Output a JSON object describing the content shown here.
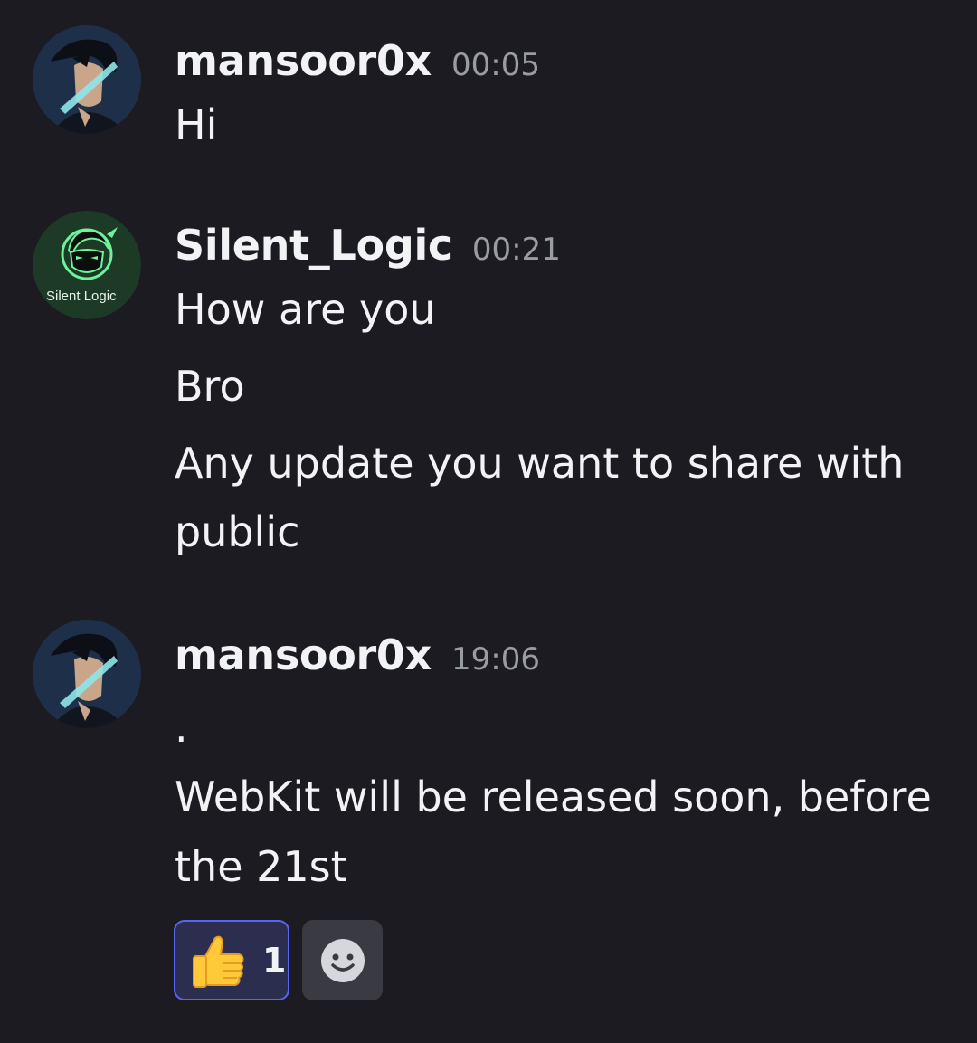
{
  "messages": [
    {
      "author": "mansoor0x",
      "time": "00:05",
      "lines": [
        "Hi"
      ],
      "avatar_icon": "user-avatar"
    },
    {
      "author": "Silent_Logic",
      "time": "00:21",
      "lines": [
        "How are you",
        "Bro",
        "Any update you want to share with",
        "public"
      ],
      "avatar_icon": "silent-logic-logo",
      "avatar_text": "Silent Logic"
    },
    {
      "author": "mansoor0x",
      "time": "19:06",
      "lines": [
        ".",
        "WebKit will be released soon, before",
        "the 21st"
      ],
      "avatar_icon": "user-avatar"
    }
  ],
  "reactions": [
    {
      "emoji": "thumbs-up-icon",
      "count": "1"
    }
  ],
  "add_reaction_icon": "smiley-add-reaction-icon",
  "colors": {
    "background": "#1b1b21",
    "timestamp": "#9a9ca3",
    "reaction_border": "#5865f2",
    "reaction_bg": "#2c2e4f"
  }
}
